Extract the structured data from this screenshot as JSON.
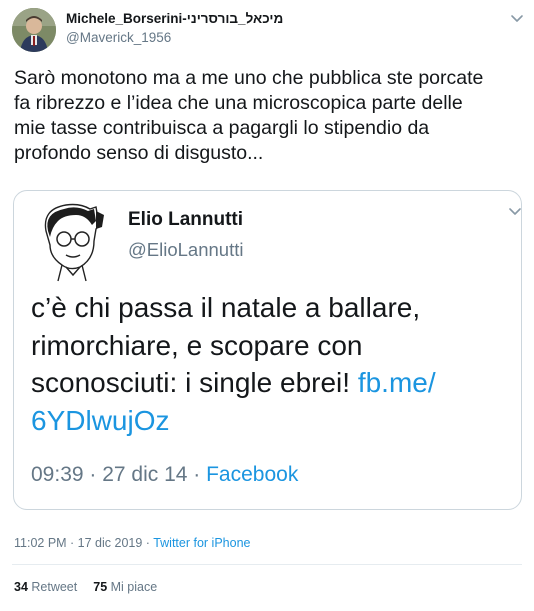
{
  "author": {
    "display_name": "Michele_Borserini-מיכאל_בורסריני",
    "handle": "@Maverick_1956"
  },
  "tweet_text": "Sarò monotono ma a me uno che pubblica ste porcate\nfa ribrezzo e l’idea che una microscopica parte delle\nmie tasse contribuisca a pagargli lo stipendio da\nprofondo senso di disgusto...",
  "quoted": {
    "name": "Elio Lannutti",
    "handle": "@ElioLannutti",
    "text_before": "c’è chi passa il natale a ballare,\nrimorchiare, e scopare con\nsconosciuti: i single ebrei! ",
    "link": "fb.me/\n6YDlwujOz",
    "meta_time": "09:39 · 27 dic 14 · ",
    "meta_source": "Facebook"
  },
  "timestamp": "11:02 PM · 17 dic 2019 · ",
  "client": "Twitter for iPhone",
  "stats": {
    "retweets_count": "34",
    "retweets_label": " Retweet",
    "likes_count": "75",
    "likes_label": " Mi piace"
  },
  "icons": {
    "header_menu": "chevron-down-icon",
    "quote_menu": "chevron-down-icon"
  },
  "colors": {
    "link": "#1b95e0",
    "secondary_text": "#657786",
    "border": "#ccd6dd"
  }
}
